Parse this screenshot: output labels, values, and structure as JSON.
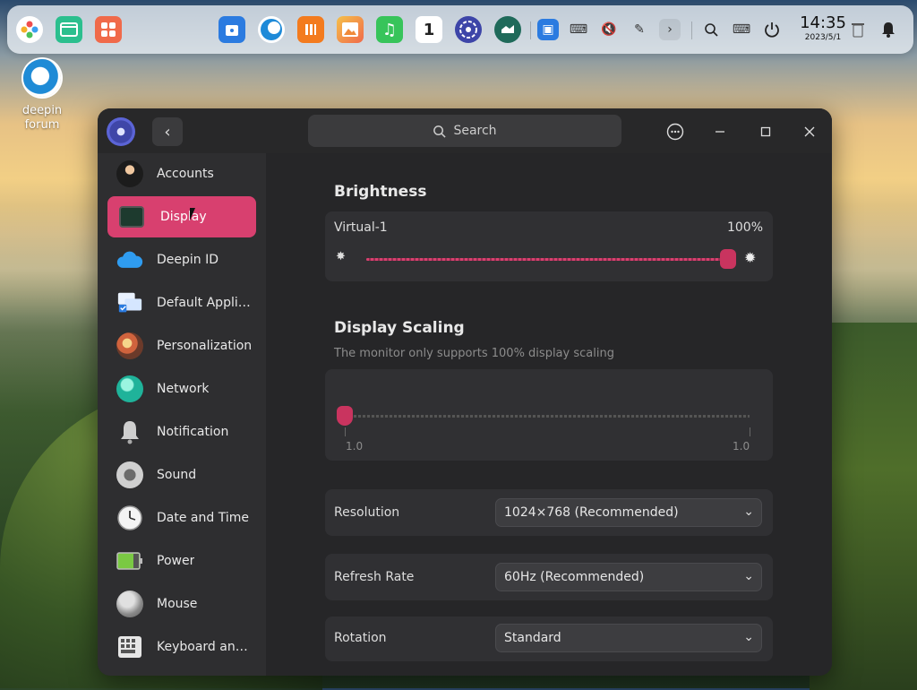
{
  "taskbar": {
    "clock_time": "14:35",
    "clock_date": "2023/5/1",
    "calendar_day": "1",
    "dock_apps": [
      {
        "name": "launcher-icon",
        "color": "#ffffff"
      },
      {
        "name": "multitask-icon",
        "color": "#2bbf8e"
      },
      {
        "name": "app-store-icon",
        "color": "#f06a4a"
      },
      {
        "name": "file-manager-icon",
        "color": "#2b7be0"
      },
      {
        "name": "browser-icon",
        "color": "#1e8ad8"
      },
      {
        "name": "market-icon",
        "color": "#f37b1e"
      },
      {
        "name": "image-viewer-icon",
        "color": "#f09a3a"
      },
      {
        "name": "music-icon",
        "color": "#37c45a"
      },
      {
        "name": "calendar-icon",
        "color": "#ffffff"
      },
      {
        "name": "control-center-icon",
        "color": "#3d45a8"
      },
      {
        "name": "deepin-id-icon",
        "color": "#1f8a6a"
      }
    ]
  },
  "desktop": {
    "icon_label_line1": "deepin",
    "icon_label_line2": "forum"
  },
  "window": {
    "search_placeholder": "Search",
    "back_symbol": "‹",
    "menu_symbol": "⋯",
    "minimize_symbol": "—",
    "maximize_symbol": "☐",
    "close_symbol": "✕",
    "accent_color": "#d8406f"
  },
  "sidebar": {
    "items": [
      {
        "label": "Accounts",
        "icon": "account-icon"
      },
      {
        "label": "Display",
        "icon": "display-icon",
        "active": true
      },
      {
        "label": "Deepin ID",
        "icon": "cloud-icon"
      },
      {
        "label": "Default Applic...",
        "icon": "default-apps-icon"
      },
      {
        "label": "Personalization",
        "icon": "palette-icon"
      },
      {
        "label": "Network",
        "icon": "network-icon"
      },
      {
        "label": "Notification",
        "icon": "bell-icon"
      },
      {
        "label": "Sound",
        "icon": "speaker-icon"
      },
      {
        "label": "Date and Time",
        "icon": "clock-icon"
      },
      {
        "label": "Power",
        "icon": "battery-icon"
      },
      {
        "label": "Mouse",
        "icon": "mouse-icon"
      },
      {
        "label": "Keyboard and ...",
        "icon": "keyboard-icon"
      }
    ]
  },
  "brightness": {
    "title": "Brightness",
    "monitor_name": "Virtual-1",
    "value_text": "100%",
    "level": 1.0
  },
  "scaling": {
    "title": "Display Scaling",
    "hint": "The monitor only supports 100% display scaling",
    "min_label": "1.0",
    "max_label": "1.0",
    "level": 0.0
  },
  "resolution": {
    "label": "Resolution",
    "value": "1024×768 (Recommended)"
  },
  "refresh_rate": {
    "label": "Refresh Rate",
    "value": "60Hz (Recommended)"
  },
  "rotation": {
    "label": "Rotation",
    "value": "Standard"
  }
}
